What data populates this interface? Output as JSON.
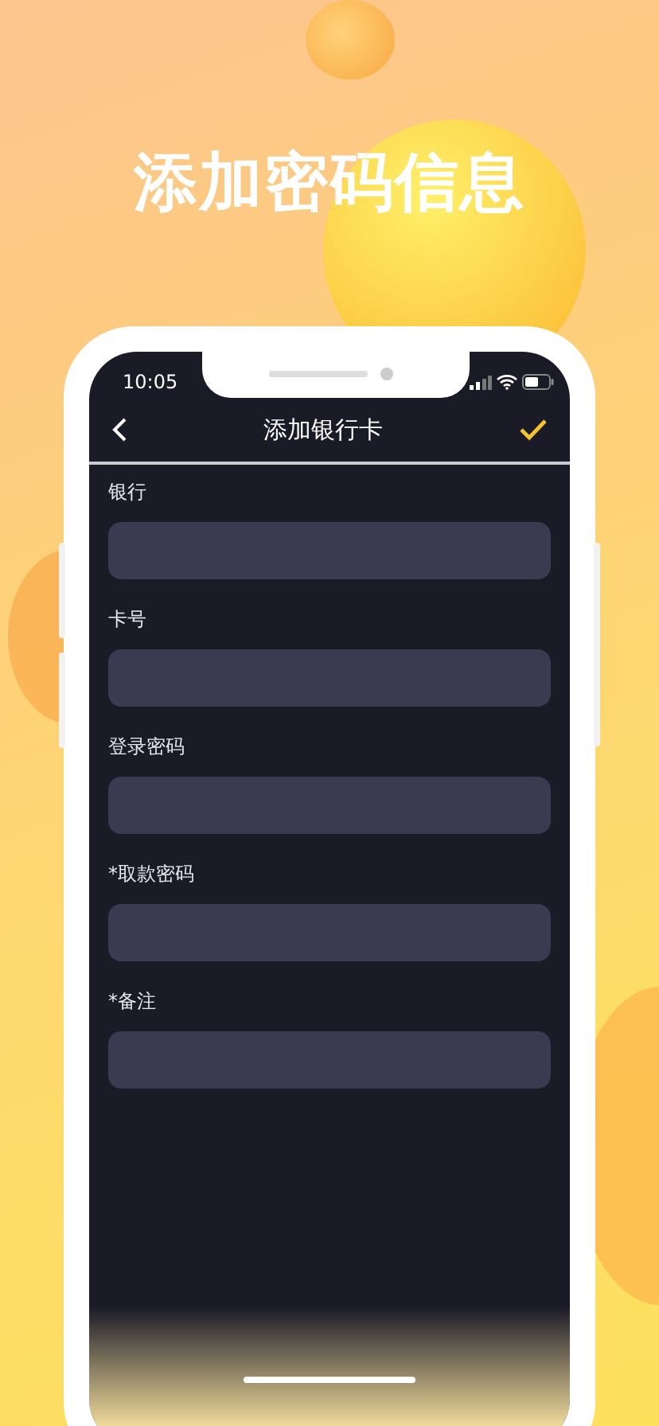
{
  "headline": "添加密码信息",
  "status_bar": {
    "time": "10:05"
  },
  "nav": {
    "title": "添加银行卡"
  },
  "fields": [
    {
      "label": "银行"
    },
    {
      "label": "卡号"
    },
    {
      "label": "登录密码"
    },
    {
      "label": "*取款密码"
    },
    {
      "label": "*备注"
    }
  ]
}
